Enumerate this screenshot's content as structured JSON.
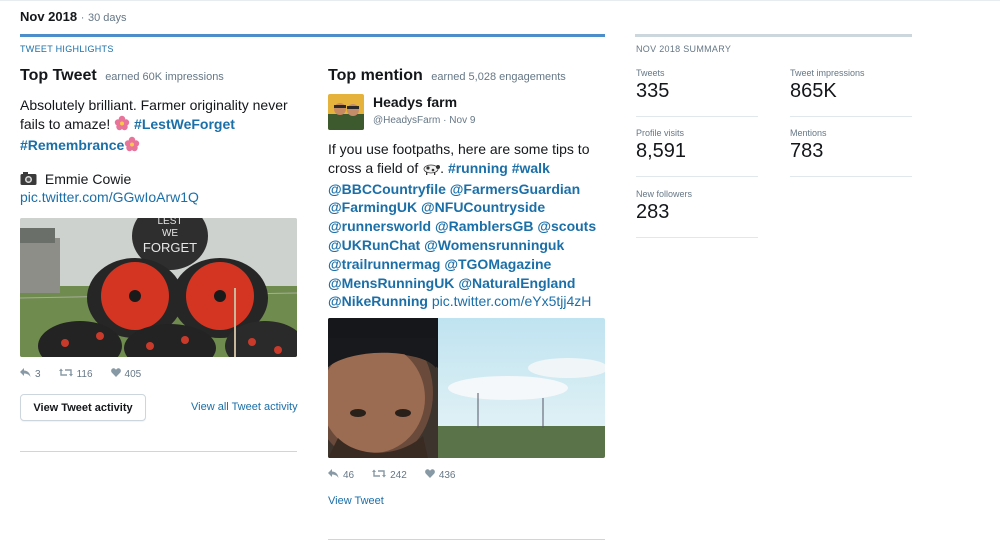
{
  "header": {
    "month": "Nov 2018",
    "separator": "·",
    "period": "30 days"
  },
  "highlights": {
    "label": "TWEET HIGHLIGHTS",
    "top_tweet": {
      "title": "Top Tweet",
      "subtitle": "earned 60K impressions",
      "text_1": "Absolutely brilliant. Farmer originality never",
      "text_2": "fails to amaze!",
      "hashtag_1": "#LestWeForget",
      "hashtag_2": "#Remembrance",
      "credit": "Emmie Cowie",
      "link": "pic.twitter.com/GGwIoArw1Q",
      "image_text": "LEST WE FORGET",
      "replies": "3",
      "retweets": "116",
      "likes": "405",
      "button": "View Tweet activity",
      "view_all": "View all Tweet activity"
    },
    "top_mention": {
      "title": "Top mention",
      "subtitle": "earned 5,028 engagements",
      "name": "Headys farm",
      "handle": "@HeadysFarm",
      "date": "Nov 9",
      "text_prefix": "If you use footpaths, here are some tips to cross a field of",
      "text_punct": ".",
      "tags": [
        "#running",
        "#walk",
        "@BBCCountryfile",
        "@FarmersGuardian",
        "@FarmingUK",
        "@NFUCountryside",
        "@runnersworld",
        "@RamblersGB",
        "@scouts",
        "@UKRunChat",
        "@Womensrunninguk",
        "@trailrunnermag",
        "@TGOMagazine",
        "@MensRunningUK",
        "@NaturalEngland",
        "@NikeRunning"
      ],
      "link": "pic.twitter.com/eYx5tjj4zH",
      "replies": "46",
      "retweets": "242",
      "likes": "436",
      "view_tweet": "View Tweet"
    }
  },
  "summary": {
    "label": "NOV 2018 SUMMARY",
    "tweets_label": "Tweets",
    "tweets_value": "335",
    "impressions_label": "Tweet impressions",
    "impressions_value": "865K",
    "profile_visits_label": "Profile visits",
    "profile_visits_value": "8,591",
    "mentions_label": "Mentions",
    "mentions_value": "783",
    "new_followers_label": "New followers",
    "new_followers_value": "283"
  },
  "colors": {
    "accent": "#1b6fa8",
    "underline": "#4b8ec9",
    "muted": "#657786"
  },
  "icons": [
    "reply-icon",
    "retweet-icon",
    "like-icon",
    "camera-icon",
    "flower-icon",
    "cow-icon"
  ]
}
